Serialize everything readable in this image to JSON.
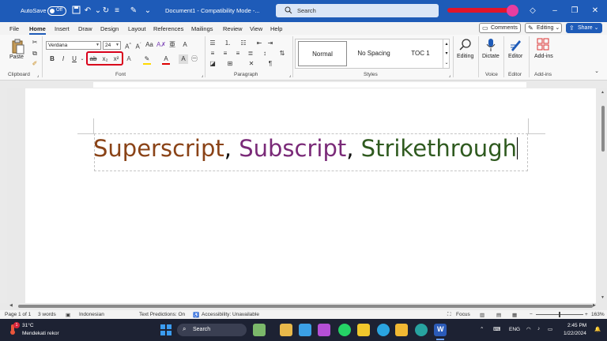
{
  "titlebar": {
    "autosave_label": "AutoSave",
    "autosave_state": "Off",
    "doc_title": "Document1 - Compatibility Mode -...",
    "search_placeholder": "Search",
    "accent": "#1e5bb8"
  },
  "menu": {
    "tabs": [
      "File",
      "Home",
      "Insert",
      "Draw",
      "Design",
      "Layout",
      "References",
      "Mailings",
      "Review",
      "View",
      "Help"
    ],
    "active": "Home",
    "comments_label": "Comments",
    "editing_label": "Editing",
    "share_label": "Share"
  },
  "ribbon": {
    "clipboard": {
      "paste_label": "Paste",
      "group_label": "Clipboard"
    },
    "font": {
      "name": "Verdana",
      "size": "24",
      "group_label": "Font",
      "subscript": "x₂",
      "superscript": "x²",
      "strike": "ab"
    },
    "paragraph": {
      "group_label": "Paragraph"
    },
    "styles": {
      "items": [
        "Normal",
        "No Spacing",
        "TOC 1"
      ],
      "group_label": "Styles"
    },
    "editing": {
      "label": "Editing"
    },
    "voice": {
      "label": "Dictate",
      "group_label": "Voice"
    },
    "editor": {
      "label": "Editor",
      "group_label": "Editor"
    },
    "addins": {
      "label": "Add-ins",
      "group_label": "Add-ins"
    }
  },
  "document": {
    "parts": [
      {
        "text": "Superscript",
        "color": "#8a4317"
      },
      {
        "text": ", ",
        "color": "#111111"
      },
      {
        "text": "Subscript",
        "color": "#7a2a78"
      },
      {
        "text": ", ",
        "color": "#111111"
      },
      {
        "text": "Strikethrough",
        "color": "#2f5a1f"
      }
    ]
  },
  "status": {
    "page": "Page 1 of 1",
    "words": "3 words",
    "language": "Indonesian",
    "predictions": "Text Predictions: On",
    "accessibility": "Accessibility: Unavailable",
    "focus": "Focus",
    "zoom": "163%"
  },
  "taskbar": {
    "weather_temp": "31°C",
    "weather_desc": "Mendekati rekor",
    "search_label": "Search",
    "lang": "ENG",
    "time": "2:45 PM",
    "date": "1/22/2024",
    "notification_count": "1"
  }
}
